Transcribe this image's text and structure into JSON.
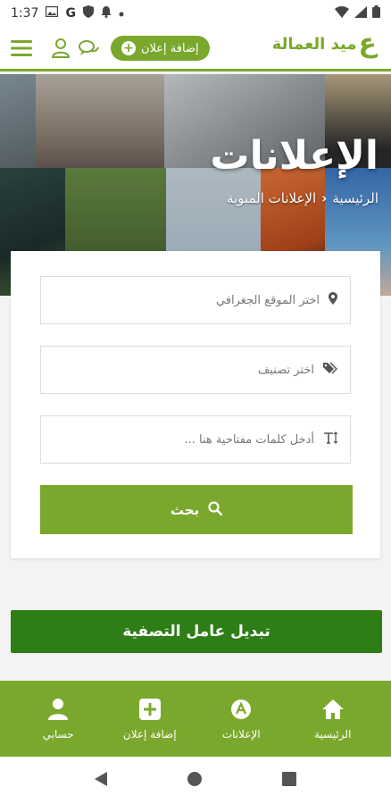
{
  "status_bar": {
    "time": "1:37",
    "g_letter": "G"
  },
  "header": {
    "logo_small": "ميد العمالة",
    "logo_big": "ع",
    "add_ad_label": "إضافة إعلان"
  },
  "hero": {
    "title": "الإعلانات",
    "breadcrumb_home": "الرئيسية",
    "breadcrumb_sep": "‹",
    "breadcrumb_current": "الإعلانات المبوبة"
  },
  "search": {
    "location_placeholder": "اختر الموقع الجغرافي",
    "category_placeholder": "اختر تصنيف",
    "keywords_placeholder": "أدخل كلمات مفتاحية هنا ...",
    "search_label": "بحث"
  },
  "filter_toggle_label": "تبديل عامل التصفية",
  "bottom_nav": [
    {
      "label": "الرئيسية",
      "icon": "home-icon"
    },
    {
      "label": "الإعلانات",
      "icon": "ads-icon"
    },
    {
      "label": "إضافة إعلان",
      "icon": "add-icon"
    },
    {
      "label": "حسابي",
      "icon": "user-icon"
    }
  ],
  "colors": {
    "brand": "#7aa82c",
    "filter_button": "#2e7d16"
  }
}
